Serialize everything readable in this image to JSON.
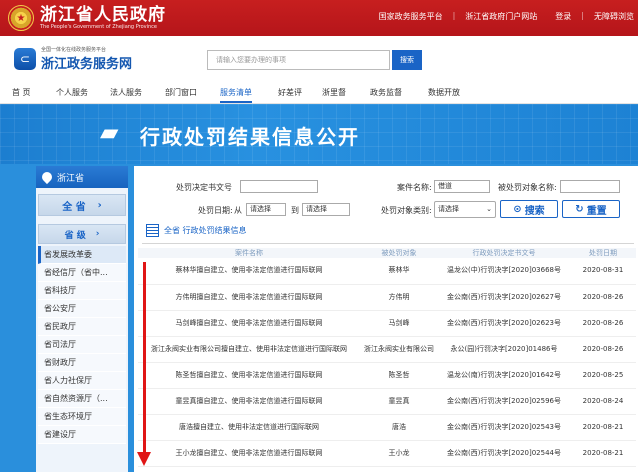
{
  "topbar": {
    "title": "浙江省人民政府",
    "subtitle": "The People's Government of Zhejiang Province",
    "links": [
      "国家政务服务平台",
      "浙江省政府门户网站",
      "登录",
      "无障碍浏览"
    ]
  },
  "site": {
    "logo_small": "全国一体化在线政务服务平台",
    "logo_name": "浙江政务服务网",
    "search_placeholder": "请输入您要办理的事项",
    "search_button": "搜索"
  },
  "nav": {
    "items": [
      "首 页",
      "个人服务",
      "法人服务",
      "部门窗口",
      "服务清单",
      "好差评",
      "浙里督",
      "政务监督",
      "数据开放"
    ],
    "active_index": 4
  },
  "banner": {
    "title": "行政处罚结果信息公开"
  },
  "sidebar": {
    "province": "浙江省",
    "all_button": "全 省",
    "level_button": "省 级",
    "departments": [
      "省发展改革委",
      "省经信厅（省中...",
      "省科技厅",
      "省公安厅",
      "省民政厅",
      "省司法厅",
      "省财政厅",
      "省人力社保厅",
      "省自然资源厅（...",
      "省生态环境厅",
      "省建设厅"
    ]
  },
  "filters": {
    "decision_no_label": "处罚决定书文号",
    "case_name_label": "案件名称:",
    "case_name_value": "借道",
    "target_name_label": "被处罚对象名称:",
    "date_label": "处罚日期:",
    "date_from_label": "从",
    "date_from_placeholder": "请选择",
    "date_to_label": "到",
    "date_to_placeholder": "请选择",
    "target_type_label": "处罚对象类别:",
    "target_type_value": "请选择",
    "search_button": "搜索",
    "reset_button": "重置"
  },
  "results": {
    "heading": "全省 行政处罚结果信息",
    "columns": [
      "案件名称",
      "被处罚对象",
      "行政处罚决定书文号",
      "处罚日期"
    ],
    "rows": [
      [
        "蔡林华擅自建立、使用非法定信道进行国际联网",
        "蔡林华",
        "温龙公(中)行罚决字[2020]03668号",
        "2020-08-31"
      ],
      [
        "方伟明擅自建立、使用非法定信道进行国际联网",
        "方伟明",
        "金公南(西)行罚决字[2020]02627号",
        "2020-08-26"
      ],
      [
        "马剑峰擅自建立、使用非法定信道进行国际联网",
        "马剑峰",
        "金公南(西)行罚决字[2020]02623号",
        "2020-08-26"
      ],
      [
        "浙江永阀实业有限公司擅自建立、使用非法定信道进行国际联网",
        "浙江永阀实业有限公司",
        "永公(园)行罚决字[2020]01486号",
        "2020-08-26"
      ],
      [
        "陈圣哲擅自建立、使用非法定信道进行国际联网",
        "陈圣哲",
        "温龙公(南)行罚决字[2020]01642号",
        "2020-08-25"
      ],
      [
        "童昱真擅自建立、使用非法定信道进行国际联网",
        "童昱真",
        "金公南(西)行罚决字[2020]02596号",
        "2020-08-24"
      ],
      [
        "唐浩擅自建立、使用非法定信道进行国际联网",
        "唐浩",
        "金公南(西)行罚决字[2020]02543号",
        "2020-08-21"
      ],
      [
        "王小龙擅自建立、使用非法定信道进行国际联网",
        "王小龙",
        "金公南(西)行罚决字[2020]02544号",
        "2020-08-21"
      ]
    ]
  },
  "colors": {
    "gov_red": "#c71f1f",
    "brand_blue": "#1a64c6",
    "banner_blue": "#2891e0",
    "annotation_arrow": "#e01515"
  }
}
